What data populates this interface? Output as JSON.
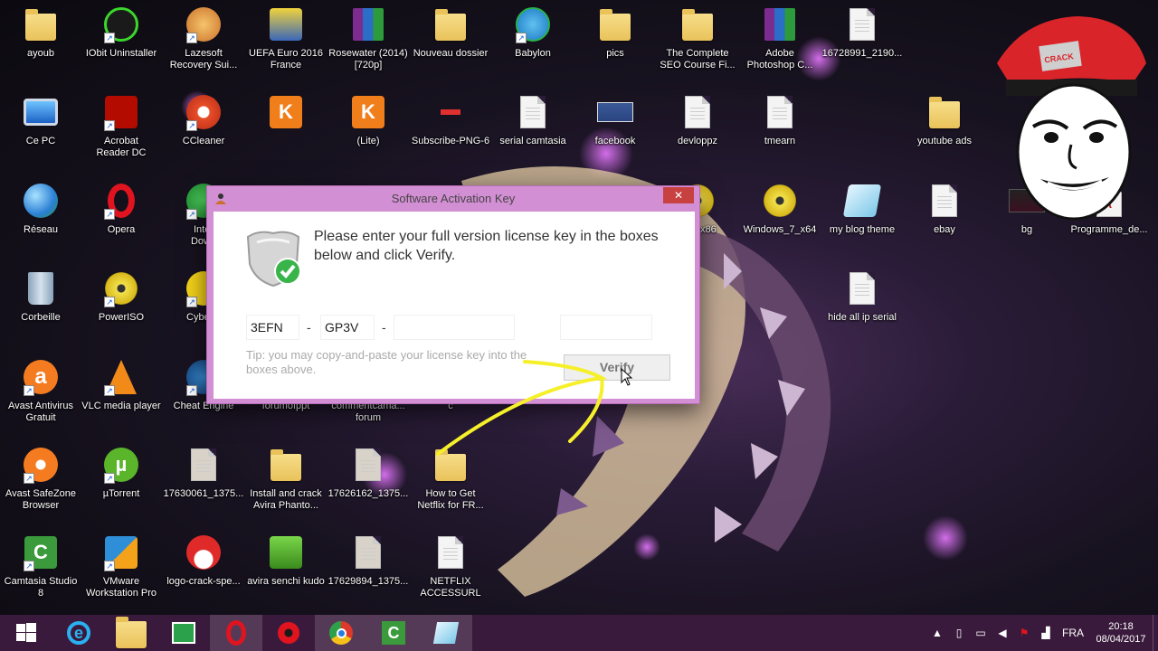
{
  "desktop": {
    "icons": [
      {
        "label": "ayoub"
      },
      {
        "label": "IObit Uninstaller"
      },
      {
        "label": "Lazesoft\nRecovery Sui..."
      },
      {
        "label": "UEFA Euro 2016\nFrance"
      },
      {
        "label": "Rosewater (2014)\n[720p]"
      },
      {
        "label": "Nouveau dossier"
      },
      {
        "label": "Babylon"
      },
      {
        "label": "pics"
      },
      {
        "label": "The Complete\nSEO Course Fi..."
      },
      {
        "label": "Adobe\nPhotoshop C..."
      },
      {
        "label": "16728991_2190..."
      },
      {
        "label": "Ce PC"
      },
      {
        "label": "Acrobat\nReader DC"
      },
      {
        "label": "CCleaner"
      },
      {
        "label": ""
      },
      {
        "label": "(Lite)"
      },
      {
        "label": "Subscribe-PNG-6"
      },
      {
        "label": "serial camtasia"
      },
      {
        "label": "facebook"
      },
      {
        "label": "devloppz"
      },
      {
        "label": "tmearn"
      },
      {
        "label": "youtube ads"
      },
      {
        "label": "Réseau"
      },
      {
        "label": "Opera"
      },
      {
        "label": "Inter\nDown"
      },
      {
        "label": "s_7_x86"
      },
      {
        "label": "Windows_7_x64"
      },
      {
        "label": "my blog theme"
      },
      {
        "label": "ebay"
      },
      {
        "label": "bg"
      },
      {
        "label": "Programme_de..."
      },
      {
        "label": "Corbeille"
      },
      {
        "label": "PowerISO"
      },
      {
        "label": "CyberG"
      },
      {
        "label": "hide all ip serial"
      },
      {
        "label": "Avast Antivirus\nGratuit"
      },
      {
        "label": "VLC media player"
      },
      {
        "label": "Cheat Engine"
      },
      {
        "label": "forumofppt"
      },
      {
        "label": "commentcama...\nforum"
      },
      {
        "label": "c"
      },
      {
        "label": "Avast SafeZone\nBrowser"
      },
      {
        "label": "µTorrent"
      },
      {
        "label": "17630061_1375..."
      },
      {
        "label": "Install and crack\nAvira Phanto..."
      },
      {
        "label": "17626162_1375..."
      },
      {
        "label": "How to Get\nNetflix for FR..."
      },
      {
        "label": "Camtasia Studio\n8"
      },
      {
        "label": "VMware\nWorkstation Pro"
      },
      {
        "label": "logo-crack-spe..."
      },
      {
        "label": "avira senchi kudo"
      },
      {
        "label": "17629894_1375..."
      },
      {
        "label": "NETFLIX\nACCESSURL"
      }
    ]
  },
  "dialog": {
    "title": "Software Activation Key",
    "close_label": "✕",
    "prompt": "Please enter your full version license key in the boxes below and click Verify.",
    "key1": "3EFN",
    "key2": "GP3V",
    "key3": "",
    "key4": "",
    "dash": "-",
    "tip": "Tip: you may copy-and-paste your license key into the boxes above.",
    "verify_label": "Verify"
  },
  "mascot": {
    "badge_text": "CRACK"
  },
  "taskbar": {
    "tray": {
      "language": "FRA",
      "time": "20:18",
      "date": "08/04/2017"
    }
  },
  "colors": {
    "dialog_frame": "#d38fd4",
    "taskbar": "#3a1a3c",
    "close": "#c74141",
    "arrow": "#f5f02a"
  }
}
